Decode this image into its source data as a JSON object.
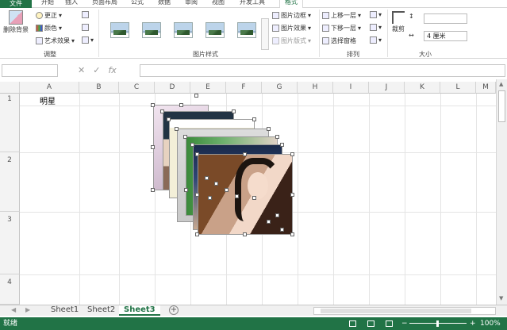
{
  "ribbon_tabs": {
    "file": "文件",
    "tabs": [
      "开始",
      "插入",
      "页面布局",
      "公式",
      "数据",
      "审阅",
      "视图",
      "开发工具",
      "格式"
    ],
    "active": "格式"
  },
  "adjust": {
    "remove_bg": "删除背景",
    "correct": "更正",
    "color": "颜色",
    "art": "艺术效果",
    "group_label": "调整"
  },
  "styles": {
    "border": "图片边框",
    "effects": "图片效果",
    "layout": "图片版式",
    "group_label": "图片样式"
  },
  "arrange": {
    "bring_forward": "上移一层",
    "send_backward": "下移一层",
    "selection_pane": "选择窗格",
    "group_label": "排列"
  },
  "size": {
    "crop": "裁剪",
    "height": "",
    "width": "4 厘米",
    "group_label": "大小"
  },
  "formula_bar": {
    "name_box": "",
    "fx": "fx",
    "formula": ""
  },
  "columns": [
    "A",
    "B",
    "C",
    "D",
    "E",
    "F",
    "G",
    "H",
    "I",
    "J",
    "K",
    "L",
    "M"
  ],
  "rows": [
    "1",
    "2",
    "3",
    "4"
  ],
  "cells": {
    "A1": "明星"
  },
  "sheets": [
    "Sheet1",
    "Sheet2",
    "Sheet3"
  ],
  "active_sheet": "Sheet3",
  "status": {
    "mode": "就绪",
    "zoom": "100%"
  }
}
